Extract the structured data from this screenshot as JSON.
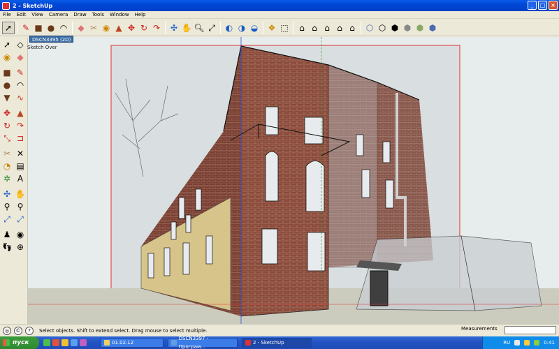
{
  "window": {
    "title": "2 - SketchUp",
    "controls": {
      "minimize": "_",
      "maximize": "□",
      "close": "×"
    }
  },
  "menu": [
    "File",
    "Edit",
    "View",
    "Camera",
    "Draw",
    "Tools",
    "Window",
    "Help"
  ],
  "toolbar": {
    "icons": [
      "select-icon",
      "pencil-icon",
      "rectangle-icon",
      "circle-icon",
      "arc-icon",
      "eraser-icon",
      "tape-measure-icon",
      "paint-bucket-icon",
      "push-pull-icon",
      "move-icon",
      "rotate-icon",
      "follow-me-icon",
      "orbit-icon",
      "pan-icon",
      "zoom-icon",
      "zoom-extents-icon",
      "previous-scene-icon",
      "next-scene-icon",
      "component-icon",
      "3d-warehouse-icon",
      "iso-view-icon",
      "top-view-icon",
      "front-view-icon",
      "right-view-icon",
      "back-view-icon",
      "left-view-icon",
      "xray-icon",
      "wireframe-icon",
      "hidden-line-icon",
      "shaded-icon",
      "shaded-textures-icon",
      "monochrome-icon"
    ]
  },
  "scene_tab": "DSCN3395 (2D)",
  "sketch_overlay_label": "Sketch Over",
  "status": {
    "hint": "Select objects. Shift to extend select. Drag mouse to select multiple.",
    "measurements_label": "Measurements",
    "measurements_value": ""
  },
  "taskbar": {
    "start_label": "пуск",
    "tasks": [
      {
        "label": "01.02.12",
        "active": false
      },
      {
        "label": "DSCN3397 - Програм...",
        "active": false
      },
      {
        "label": "2 - SketchUp",
        "active": true
      }
    ],
    "language": "RU",
    "clock": "0:41"
  },
  "colors": {
    "accent": "#0046d5",
    "brick": "#8a4a3a",
    "axis_red": "#e03030",
    "axis_green": "#2a8a2a",
    "axis_blue": "#3050d0"
  }
}
